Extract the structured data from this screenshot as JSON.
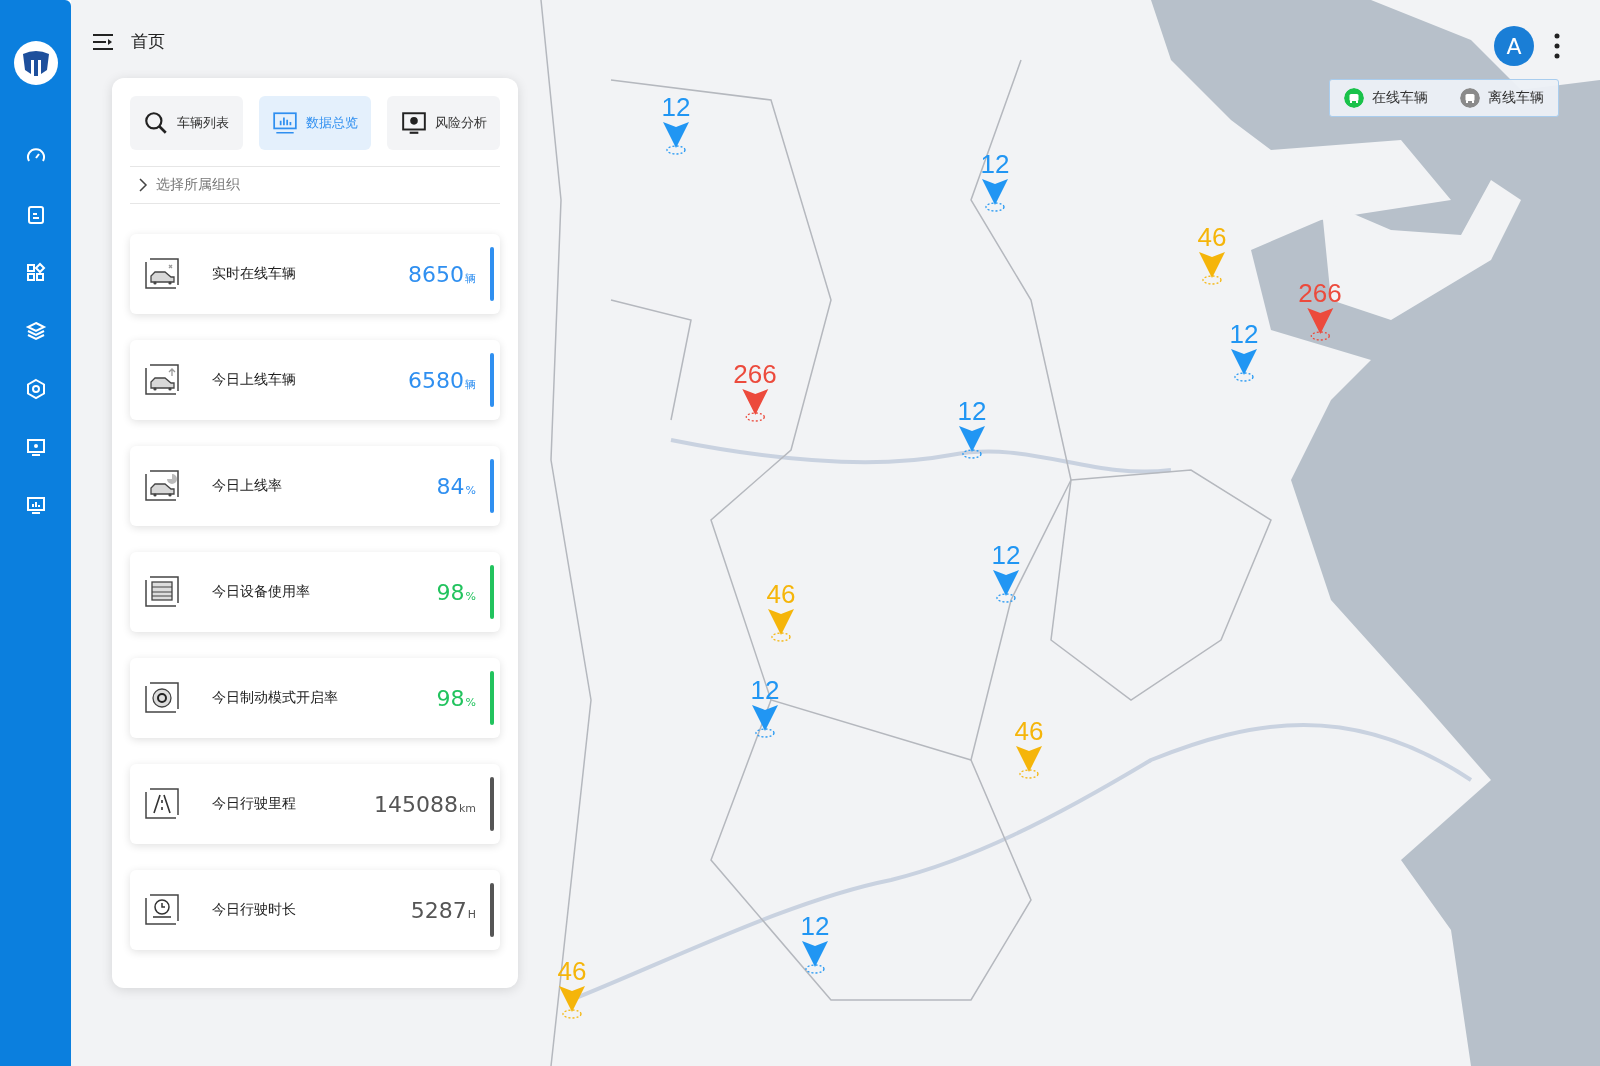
{
  "header": {
    "title": "首页"
  },
  "tabs": [
    {
      "label": "车辆列表",
      "kind": "search",
      "selected": false
    },
    {
      "label": "数据总览",
      "kind": "chart",
      "selected": true
    },
    {
      "label": "风险分析",
      "kind": "monitor",
      "selected": false
    }
  ],
  "org_selector": {
    "label": "选择所属组织"
  },
  "stats": [
    {
      "kind": "vehicle",
      "label": "实时在线车辆",
      "value": "8650",
      "unit": "辆",
      "color": "#2f8ff0"
    },
    {
      "kind": "upload",
      "label": "今日上线车辆",
      "value": "6580",
      "unit": "辆",
      "color": "#2f8ff0"
    },
    {
      "kind": "rate",
      "label": "今日上线率",
      "value": "84",
      "unit": "%",
      "color": "#2f8ff0"
    },
    {
      "kind": "device",
      "label": "今日设备使用率",
      "value": "98",
      "unit": "%",
      "color": "#22c35e"
    },
    {
      "kind": "brake",
      "label": "今日制动模式开启率",
      "value": "98",
      "unit": "%",
      "color": "#22c35e"
    },
    {
      "kind": "road",
      "label": "今日行驶里程",
      "value": "145088",
      "unit": "km",
      "color": "#555555"
    },
    {
      "kind": "clock",
      "label": "今日行驶时长",
      "value": "5287",
      "unit": "H",
      "color": "#555555"
    }
  ],
  "avatar": "A",
  "legend": [
    {
      "label": "在线车辆",
      "color": "#19c24a"
    },
    {
      "label": "离线车辆",
      "color": "#8a8a8a"
    }
  ],
  "markers": [
    {
      "count": "12",
      "color": "#2196f3"
    },
    {
      "count": "12",
      "color": "#2196f3"
    },
    {
      "count": "46",
      "color": "#f5b50a"
    },
    {
      "count": "266",
      "color": "#ec4a3c"
    },
    {
      "count": "12",
      "color": "#2196f3"
    },
    {
      "count": "266",
      "color": "#ec4a3c"
    },
    {
      "count": "12",
      "color": "#2196f3"
    },
    {
      "count": "12",
      "color": "#2196f3"
    },
    {
      "count": "46",
      "color": "#f5b50a"
    },
    {
      "count": "12",
      "color": "#2196f3"
    },
    {
      "count": "46",
      "color": "#f5b50a"
    },
    {
      "count": "12",
      "color": "#2196f3"
    },
    {
      "count": "46",
      "color": "#f5b50a"
    }
  ]
}
